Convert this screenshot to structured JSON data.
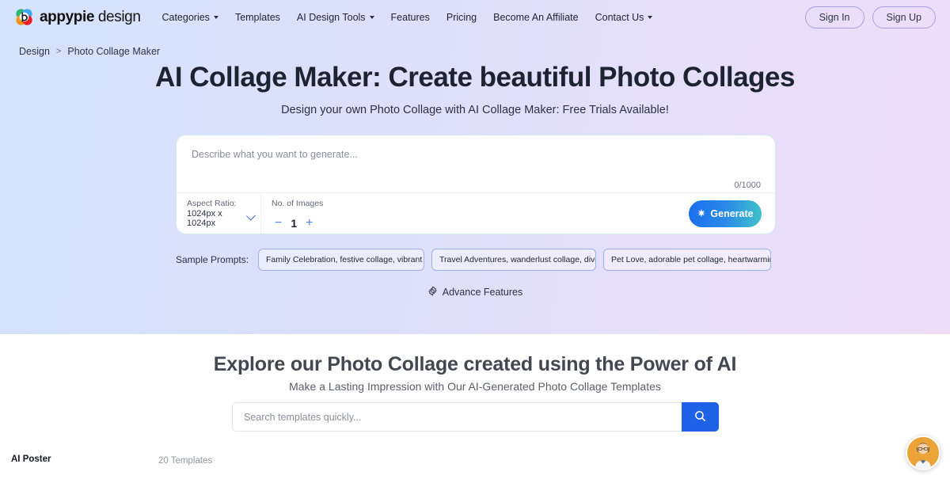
{
  "brand": {
    "name_bold": "appypie",
    "name_light": "design",
    "logo_icon": "appypie-flower-logo"
  },
  "nav": {
    "items": [
      {
        "label": "Categories",
        "has_caret": true
      },
      {
        "label": "Templates",
        "has_caret": false
      },
      {
        "label": "AI Design Tools",
        "has_caret": true
      },
      {
        "label": "Features",
        "has_caret": false
      },
      {
        "label": "Pricing",
        "has_caret": false
      },
      {
        "label": "Become An Affiliate",
        "has_caret": false
      },
      {
        "label": "Contact Us",
        "has_caret": true
      }
    ],
    "sign_in": "Sign In",
    "sign_up": "Sign Up"
  },
  "breadcrumb": {
    "root": "Design",
    "separator": ">",
    "current": "Photo Collage Maker"
  },
  "hero": {
    "title": "AI Collage Maker: Create beautiful Photo Collages",
    "subtitle": "Design your own Photo Collage with AI Collage Maker: Free Trials Available!"
  },
  "generator": {
    "prompt_value": "",
    "prompt_placeholder": "Describe what you want to generate...",
    "char_count": "0/1000",
    "aspect_ratio_label": "Aspect Ratio:",
    "aspect_ratio_value": "1024px x 1024px",
    "images_label": "No. of Images",
    "images_decrement": "−",
    "images_value": "1",
    "images_increment": "+",
    "generate_label": "Generate",
    "generate_icon": "sparkle-icon",
    "generate_gradient_from": "#1a6ef0",
    "generate_gradient_to": "#3fc3c8"
  },
  "sample_prompts": {
    "label": "Sample Prompts:",
    "chips": [
      "Family Celebration, festive collage, vibrant col...",
      "Travel Adventures, wanderlust collage, diverse...",
      "Pet Love, adorable pet collage, heartwarming ..."
    ]
  },
  "advance_features": {
    "label": "Advance Features",
    "icon": "gear-icon"
  },
  "explore": {
    "title": "Explore our Photo Collage created using the Power of AI",
    "subtitle": "Make a Lasting Impression with Our AI-Generated Photo Collage Templates",
    "search_value": "",
    "search_placeholder": "Search templates quickly...",
    "search_icon": "search-icon",
    "search_button_color": "#1f62e8"
  },
  "bottom_strip": {
    "category": "AI Poster",
    "count": "20 Templates"
  },
  "chat_widget": {
    "icon": "support-agent-avatar",
    "background": "#eba437"
  }
}
